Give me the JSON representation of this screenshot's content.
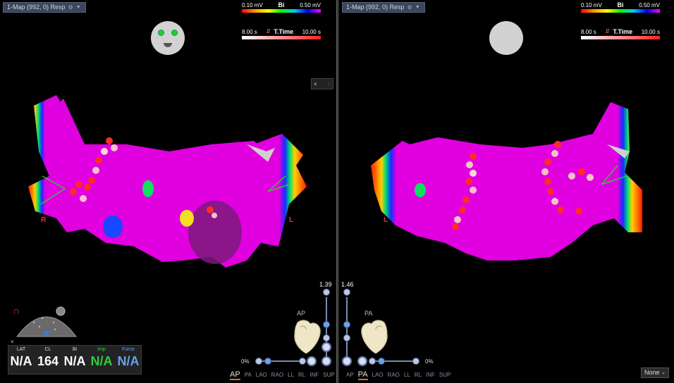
{
  "left": {
    "map_title": "1-Map (992, 0) Resp",
    "bi_legend": {
      "min": "0.10 mV",
      "label": "Bi",
      "max": "0.50 mV"
    },
    "ttime_legend": {
      "min": "8.00 s",
      "label": "T.Time",
      "max": "10.00 s"
    },
    "orientation": "AP",
    "scale": "1.39",
    "opacity_pct": "0%",
    "marker_r": "R",
    "marker_l": "L",
    "views": [
      "AP",
      "PA",
      "LAO",
      "RAO",
      "LL",
      "RL",
      "INF",
      "SUP"
    ],
    "selected_view": "AP"
  },
  "right": {
    "map_title": "1-Map (992, 0) Resp",
    "bi_legend": {
      "min": "0.10 mV",
      "label": "Bi",
      "max": "0.50 mV"
    },
    "ttime_legend": {
      "min": "8.00 s",
      "label": "T.Time",
      "max": "10.00 s"
    },
    "orientation": "PA",
    "scale": "1.46",
    "opacity_pct": "0%",
    "marker_l": "L",
    "views": [
      "AP",
      "PA",
      "LAO",
      "RAO",
      "LL",
      "RL",
      "INF",
      "SUP"
    ],
    "selected_view": "PA"
  },
  "stats": {
    "lat": {
      "label": "LAT",
      "value": "N/A"
    },
    "cl": {
      "label": "CL",
      "value": "164"
    },
    "bi": {
      "label": "Bi",
      "value": "N/A"
    },
    "imp": {
      "label": "Imp",
      "value": "N/A"
    },
    "force": {
      "label": "Force",
      "value": "N/A"
    }
  },
  "none_select": "None",
  "colors": {
    "imp": "#2ecc40",
    "force": "#6aa0e8",
    "ttime": "#ff2020"
  }
}
